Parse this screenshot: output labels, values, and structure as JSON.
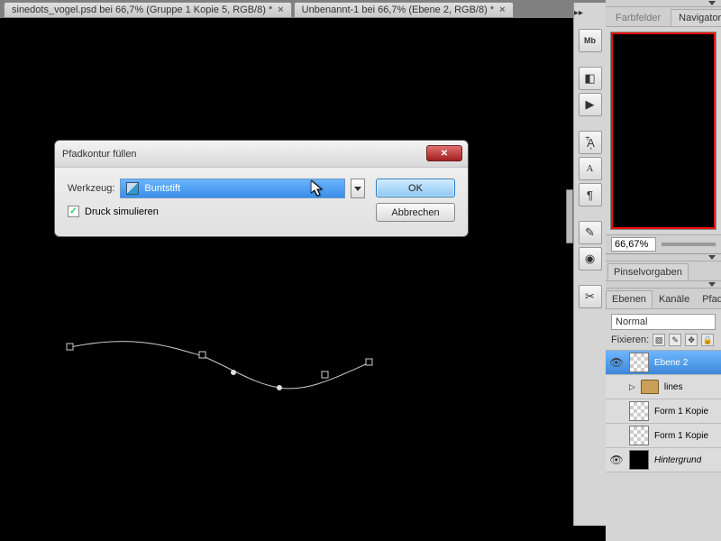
{
  "tabs": [
    {
      "label": "sinedots_vogel.psd bei 66,7% (Gruppe 1 Kopie 5, RGB/8) *"
    },
    {
      "label": "Unbenannt-1 bei 66,7% (Ebene 2, RGB/8) *"
    }
  ],
  "dialog": {
    "title": "Pfadkontur füllen",
    "tool_label": "Werkzeug:",
    "tool_value": "Buntstift",
    "simulate_pressure": "Druck simulieren",
    "ok": "OK",
    "cancel": "Abbrechen"
  },
  "navigator": {
    "tabs": {
      "swatches": "Farbfelder",
      "navigator": "Navigator"
    },
    "zoom": "66,67%"
  },
  "brush": {
    "tab": "Pinselvorgaben"
  },
  "layers": {
    "tabs": {
      "layers": "Ebenen",
      "channels": "Kanäle",
      "paths": "Pfade"
    },
    "blend_mode": "Normal",
    "lock_label": "Fixieren:",
    "rows": [
      {
        "name": "Ebene 2",
        "thumb": "checker",
        "selected": true,
        "eye": true
      },
      {
        "name": "lines",
        "thumb": "folder",
        "selected": false,
        "eye": false,
        "folder": true
      },
      {
        "name": "Form 1 Kopie",
        "thumb": "checker",
        "selected": false,
        "eye": false
      },
      {
        "name": "Form 1 Kopie",
        "thumb": "checker",
        "selected": false,
        "eye": false
      },
      {
        "name": "Hintergrund",
        "thumb": "black",
        "selected": false,
        "eye": true,
        "italic": true
      }
    ]
  }
}
